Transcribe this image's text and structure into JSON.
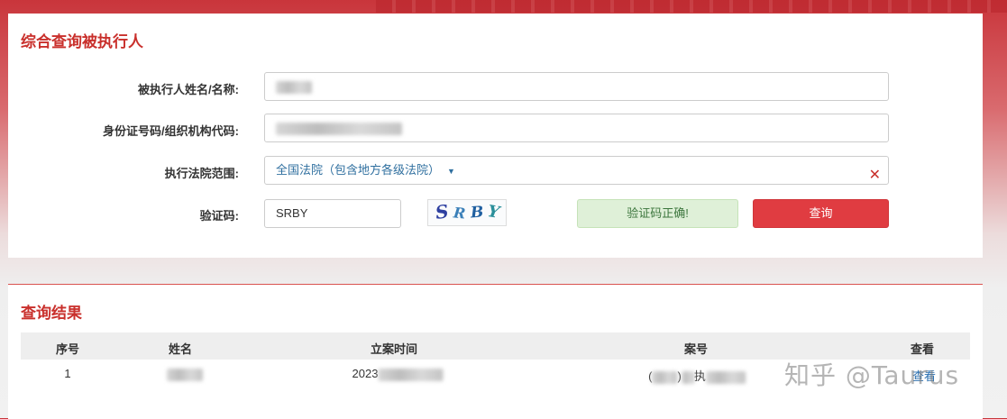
{
  "search_panel": {
    "title": "综合查询被执行人",
    "name_label": "被执行人姓名/名称:",
    "id_label": "身份证号码/组织机构代码:",
    "court_label": "执行法院范围:",
    "court_value": "全国法院（包含地方各级法院）",
    "captcha_label": "验证码:",
    "captcha_input_value": "SRBY",
    "captcha_image_text": [
      "S",
      "R",
      "B",
      "Y"
    ],
    "captcha_colors": [
      "#2d3fa0",
      "#3a7fb8",
      "#1f5fa0",
      "#2a8f9a"
    ],
    "verify_status": "验证码正确!",
    "query_button": "查询",
    "clear_icon": "close-icon"
  },
  "results_panel": {
    "title": "查询结果",
    "columns": [
      "序号",
      "姓名",
      "立案时间",
      "案号",
      "查看"
    ],
    "rows": [
      {
        "index": "1",
        "case_date_prefix": "2023",
        "case_no_a": "(",
        "case_no_b": ")",
        "case_no_c": "执",
        "view": "查看"
      }
    ]
  },
  "watermark": "知乎 @Taurus",
  "colors": {
    "title_red": "#c9302c",
    "button_red": "#e03c41",
    "success_bg": "#dff0d8",
    "link_blue": "#2a6fb0"
  }
}
